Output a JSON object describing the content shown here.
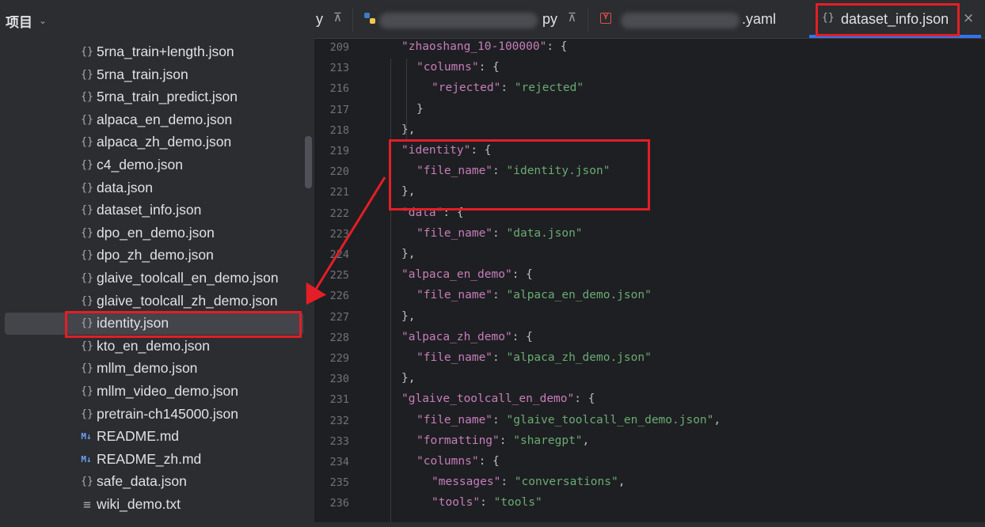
{
  "project": {
    "title": "项目",
    "files": [
      {
        "name": "5rna_train+length.json",
        "type": "json"
      },
      {
        "name": "5rna_train.json",
        "type": "json"
      },
      {
        "name": "5rna_train_predict.json",
        "type": "json"
      },
      {
        "name": "alpaca_en_demo.json",
        "type": "json"
      },
      {
        "name": "alpaca_zh_demo.json",
        "type": "json"
      },
      {
        "name": "c4_demo.json",
        "type": "json"
      },
      {
        "name": "data.json",
        "type": "json"
      },
      {
        "name": "dataset_info.json",
        "type": "json"
      },
      {
        "name": "dpo_en_demo.json",
        "type": "json"
      },
      {
        "name": "dpo_zh_demo.json",
        "type": "json"
      },
      {
        "name": "glaive_toolcall_en_demo.json",
        "type": "json"
      },
      {
        "name": "glaive_toolcall_zh_demo.json",
        "type": "json"
      },
      {
        "name": "identity.json",
        "type": "json",
        "selected": true
      },
      {
        "name": "kto_en_demo.json",
        "type": "json"
      },
      {
        "name": "mllm_demo.json",
        "type": "json"
      },
      {
        "name": "mllm_video_demo.json",
        "type": "json"
      },
      {
        "name": "pretrain-ch145000.json",
        "type": "json"
      },
      {
        "name": "README.md",
        "type": "md"
      },
      {
        "name": "README_zh.md",
        "type": "md"
      },
      {
        "name": "safe_data.json",
        "type": "json"
      },
      {
        "name": "wiki_demo.txt",
        "type": "txt"
      }
    ]
  },
  "icons": {
    "json": "{}",
    "md": "M↓",
    "txt": "≡",
    "pin": "⊼",
    "close": "×",
    "chevron": "⌄"
  },
  "tabs": [
    {
      "label": "y",
      "pinned": true
    },
    {
      "label": "py",
      "pinned": true,
      "icon": "python-icon"
    },
    {
      "label": ".yaml",
      "icon": "yaml-icon"
    },
    {
      "label": "dataset_info.json",
      "active": true,
      "icon": "json-icon"
    }
  ],
  "code_lines": [
    {
      "n": "209",
      "indent": 0,
      "parts": [
        [
          "k",
          "\"zhaoshang_10-100000\""
        ],
        [
          "p",
          ": {"
        ]
      ]
    },
    {
      "n": "213",
      "indent": 1,
      "parts": [
        [
          "k",
          "\"columns\""
        ],
        [
          "p",
          ": {"
        ]
      ]
    },
    {
      "n": "216",
      "indent": 2,
      "parts": [
        [
          "k",
          "\"rejected\""
        ],
        [
          "p",
          ": "
        ],
        [
          "s",
          "\"rejected\""
        ]
      ]
    },
    {
      "n": "217",
      "indent": 1,
      "parts": [
        [
          "p",
          "}"
        ]
      ]
    },
    {
      "n": "218",
      "indent": 0,
      "parts": [
        [
          "p",
          "},"
        ]
      ]
    },
    {
      "n": "219",
      "indent": 0,
      "parts": [
        [
          "k",
          "\"identity\""
        ],
        [
          "p",
          ": {"
        ]
      ]
    },
    {
      "n": "220",
      "indent": 1,
      "parts": [
        [
          "k",
          "\"file_name\""
        ],
        [
          "p",
          ": "
        ],
        [
          "s",
          "\"identity.json\""
        ]
      ]
    },
    {
      "n": "221",
      "indent": 0,
      "parts": [
        [
          "p",
          "},"
        ]
      ]
    },
    {
      "n": "222",
      "indent": 0,
      "parts": [
        [
          "k",
          "\"data\""
        ],
        [
          "p",
          ": {"
        ]
      ]
    },
    {
      "n": "223",
      "indent": 1,
      "parts": [
        [
          "k",
          "\"file_name\""
        ],
        [
          "p",
          ": "
        ],
        [
          "s",
          "\"data.json\""
        ]
      ]
    },
    {
      "n": "224",
      "indent": 0,
      "parts": [
        [
          "p",
          "},"
        ]
      ]
    },
    {
      "n": "225",
      "indent": 0,
      "parts": [
        [
          "k",
          "\"alpaca_en_demo\""
        ],
        [
          "p",
          ": {"
        ]
      ]
    },
    {
      "n": "226",
      "indent": 1,
      "parts": [
        [
          "k",
          "\"file_name\""
        ],
        [
          "p",
          ": "
        ],
        [
          "s",
          "\"alpaca_en_demo.json\""
        ]
      ]
    },
    {
      "n": "227",
      "indent": 0,
      "parts": [
        [
          "p",
          "},"
        ]
      ]
    },
    {
      "n": "228",
      "indent": 0,
      "parts": [
        [
          "k",
          "\"alpaca_zh_demo\""
        ],
        [
          "p",
          ": {"
        ]
      ]
    },
    {
      "n": "229",
      "indent": 1,
      "parts": [
        [
          "k",
          "\"file_name\""
        ],
        [
          "p",
          ": "
        ],
        [
          "s",
          "\"alpaca_zh_demo.json\""
        ]
      ]
    },
    {
      "n": "230",
      "indent": 0,
      "parts": [
        [
          "p",
          "},"
        ]
      ]
    },
    {
      "n": "231",
      "indent": 0,
      "parts": [
        [
          "k",
          "\"glaive_toolcall_en_demo\""
        ],
        [
          "p",
          ": {"
        ]
      ]
    },
    {
      "n": "232",
      "indent": 1,
      "parts": [
        [
          "k",
          "\"file_name\""
        ],
        [
          "p",
          ": "
        ],
        [
          "s",
          "\"glaive_toolcall_en_demo.json\""
        ],
        [
          "p",
          ","
        ]
      ]
    },
    {
      "n": "233",
      "indent": 1,
      "parts": [
        [
          "k",
          "\"formatting\""
        ],
        [
          "p",
          ": "
        ],
        [
          "s",
          "\"sharegpt\""
        ],
        [
          "p",
          ","
        ]
      ]
    },
    {
      "n": "234",
      "indent": 1,
      "parts": [
        [
          "k",
          "\"columns\""
        ],
        [
          "p",
          ": {"
        ]
      ]
    },
    {
      "n": "235",
      "indent": 2,
      "parts": [
        [
          "k",
          "\"messages\""
        ],
        [
          "p",
          ": "
        ],
        [
          "s",
          "\"conversations\""
        ],
        [
          "p",
          ","
        ]
      ]
    },
    {
      "n": "236",
      "indent": 2,
      "parts": [
        [
          "k",
          "\"tools\""
        ],
        [
          "p",
          ": "
        ],
        [
          "s",
          "\"tools\""
        ]
      ]
    }
  ],
  "colors": {
    "highlight": "#e41e26",
    "key": "#c77dbb",
    "string": "#6aab73",
    "accent": "#3574f0"
  }
}
